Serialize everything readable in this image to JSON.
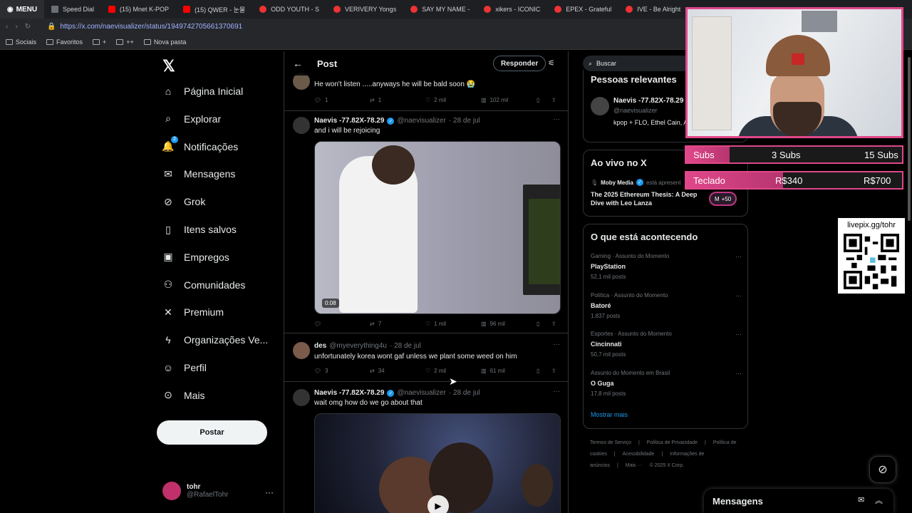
{
  "browser": {
    "menu_label": "MENU",
    "tabs": [
      {
        "label": "Speed Dial",
        "icon": "grid"
      },
      {
        "label": "(15) Mnet K-POP",
        "icon": "youtube"
      },
      {
        "label": "(15) QWER - 눈물",
        "icon": "youtube"
      },
      {
        "label": "ODD YOUTH - S",
        "icon": "site"
      },
      {
        "label": "VERIVERY Yongs",
        "icon": "site"
      },
      {
        "label": "SAY MY NAME -",
        "icon": "site"
      },
      {
        "label": "xikers - ICONIC",
        "icon": "site"
      },
      {
        "label": "EPEX - Grateful",
        "icon": "site"
      },
      {
        "label": "IVE - Be Alright",
        "icon": "site"
      }
    ],
    "url": "https://x.com/naevisualizer/status/1949742705661370691",
    "bookmarks": [
      "Sociais",
      "Favoritos",
      "+",
      "++",
      "Nova pasta"
    ]
  },
  "nav": {
    "items": [
      {
        "label": "Página Inicial",
        "icon": "home-icon",
        "glyph": "⌂"
      },
      {
        "label": "Explorar",
        "icon": "search-icon",
        "glyph": "⌕"
      },
      {
        "label": "Notificações",
        "icon": "bell-icon",
        "glyph": "🔔",
        "badge": "2"
      },
      {
        "label": "Mensagens",
        "icon": "envelope-icon",
        "glyph": "✉"
      },
      {
        "label": "Grok",
        "icon": "grok-icon",
        "glyph": "⊘"
      },
      {
        "label": "Itens salvos",
        "icon": "bookmark-icon",
        "glyph": "▯"
      },
      {
        "label": "Empregos",
        "icon": "briefcase-icon",
        "glyph": "▣"
      },
      {
        "label": "Comunidades",
        "icon": "people-icon",
        "glyph": "⚇"
      },
      {
        "label": "Premium",
        "icon": "x-premium-icon",
        "glyph": "✕"
      },
      {
        "label": "Organizações Ve...",
        "icon": "lightning-icon",
        "glyph": "ϟ"
      },
      {
        "label": "Perfil",
        "icon": "person-icon",
        "glyph": "☺"
      },
      {
        "label": "Mais",
        "icon": "more-circle-icon",
        "glyph": "⊙"
      }
    ],
    "post_label": "Postar",
    "me": {
      "name": "tohr",
      "handle": "@RafaelTohr"
    }
  },
  "main": {
    "title": "Post",
    "reply_label": "Responder",
    "tweets": [
      {
        "text": "He won't listen .....anyways he will be bald soon 😭",
        "replies": "1",
        "retweets": "1",
        "likes": "2 mil",
        "views": "102 mil"
      },
      {
        "name": "Naevis -77.82X-78.29",
        "handle": "@naevisualizer",
        "date": "· 28 de jul",
        "text": "and i will be rejoicing",
        "duration": "0:08",
        "replies": "",
        "retweets": "7",
        "likes": "1 mil",
        "views": "96 mil"
      },
      {
        "name": "des",
        "handle": "@myeverything4u",
        "date": "· 28 de jul",
        "text": "unfortunately korea wont gaf unless we plant some weed on him",
        "replies": "3",
        "retweets": "34",
        "likes": "2 mil",
        "views": "61 mil"
      },
      {
        "name": "Naevis -77.82X-78.29",
        "handle": "@naevisualizer",
        "date": "· 28 de jul",
        "text": "wait omg how do we go about that"
      }
    ]
  },
  "right": {
    "search_placeholder": "Buscar",
    "relevant": {
      "title": "Pessoas relevantes",
      "name": "Naevis -77.82X-78.29",
      "handle": "@naevisualizer",
      "bio": "kpop + FLO, Ethel Cain, Arca, Björk."
    },
    "live": {
      "title": "Ao vivo no X",
      "host": "Moby Media",
      "status": "está apresent",
      "event": "The 2025 Ethereum Thesis: A Deep Dive with Leo Lanza",
      "count": "+50"
    },
    "trends": {
      "title": "O que está acontecendo",
      "items": [
        {
          "meta": "Gaming · Assunto do Momento",
          "topic": "PlayStation",
          "posts": "52,1 mil posts"
        },
        {
          "meta": "Política · Assunto do Momento",
          "topic": "Batoré",
          "posts": "1.837 posts"
        },
        {
          "meta": "Esportes · Assunto do Momento",
          "topic": "Cincinnati",
          "posts": "50,7 mil posts"
        },
        {
          "meta": "Assunto do Momento em Brasil",
          "topic": "O Guga",
          "posts": "17,8 mil posts"
        }
      ],
      "show_more": "Mostrar mais"
    },
    "footer": [
      "Termos de Serviço",
      "|",
      "Política de Privacidade",
      "|",
      "Política de cookies",
      "|",
      "Acessibilidade",
      "|",
      "Informações de anúncios",
      "|",
      "Mais ···",
      "© 2025 X Corp."
    ]
  },
  "messages_dock": {
    "title": "Mensagens"
  },
  "overlay": {
    "subs": {
      "label": "Subs",
      "current": "3 Subs",
      "goal": "15 Subs",
      "progress": 0.2
    },
    "teclado": {
      "label": "Teclado",
      "current": "R$340",
      "goal": "R$700",
      "progress": 0.45
    },
    "livepix": "livepix.gg/tohr"
  },
  "colors": {
    "accent": "#1d9bf0",
    "overlay_pink": "#e0478a",
    "background": "#000000"
  }
}
